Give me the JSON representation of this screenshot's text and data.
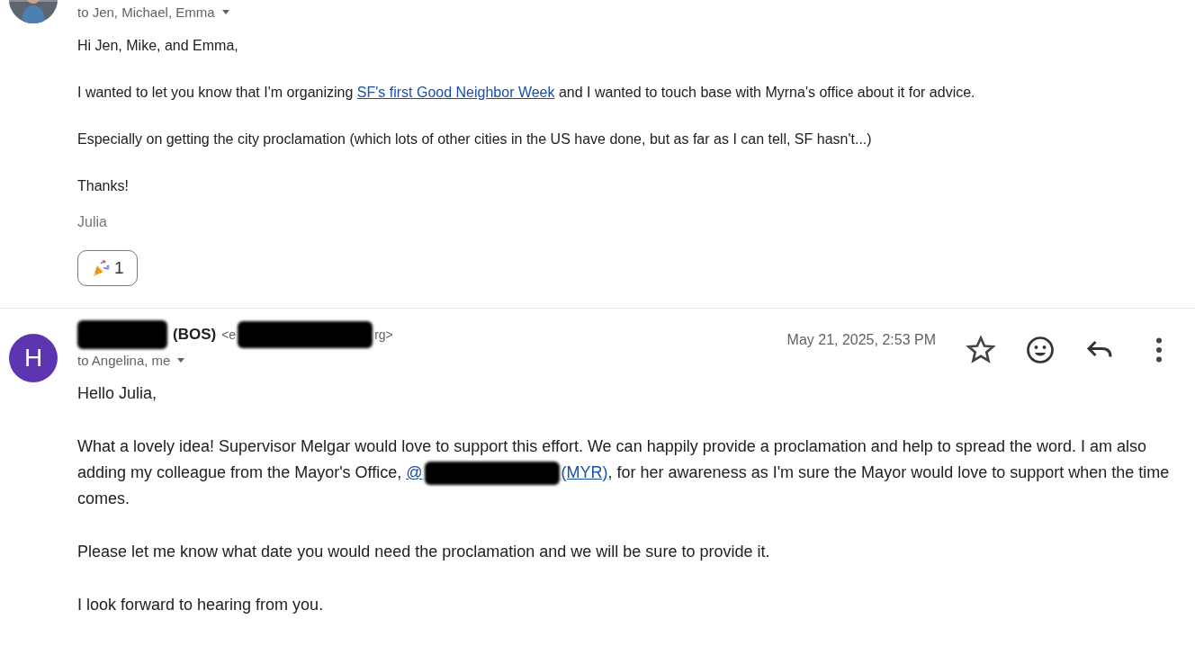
{
  "messages": [
    {
      "avatar": {
        "kind": "picture"
      },
      "recipients": "to Jen, Michael, Emma",
      "paragraphs": [
        [
          {
            "kind": "text",
            "text": "Hi Jen, Mike, and Emma,"
          }
        ],
        [
          {
            "kind": "text",
            "text": "I wanted to let you know that I'm organizing "
          },
          {
            "kind": "link",
            "text": "SF's first Good Neighbor Week"
          },
          {
            "kind": "text",
            "text": " and I wanted to touch base with Myrna's office about it for advice."
          }
        ],
        [
          {
            "kind": "text",
            "text": "Especially on getting the city proclamation (which lots of other cities in the US have done, but as far as I can tell, SF hasn't...)"
          }
        ],
        [
          {
            "kind": "text",
            "text": "Thanks!"
          }
        ]
      ],
      "signature": "Julia",
      "reactions": [
        {
          "count": "1"
        }
      ]
    },
    {
      "avatar": {
        "kind": "letter",
        "letter": "H",
        "color": "#5e35b1"
      },
      "sender": {
        "name": "(BOS)",
        "email_start": "<e",
        "email_end": "rg>"
      },
      "date": "May 21, 2025, 2:53 PM",
      "recipients": "to Angelina, me",
      "paragraphs": [
        [
          {
            "kind": "text",
            "text": "Hello Julia,"
          }
        ],
        [
          {
            "kind": "text",
            "text": "What a lovely idea! Supervisor Melgar would love to support this effort. We can happily provide a proclamation and help to spread the word. I am also adding my colleague from the Mayor's Office, "
          },
          {
            "kind": "mention",
            "start": "@",
            "end": " (MYR)"
          },
          {
            "kind": "text",
            "text": ", for her awareness as I'm sure the Mayor would love to support when the time comes."
          }
        ],
        [
          {
            "kind": "text",
            "text": "Please let me know what date you would need the proclamation and we will be sure to provide it."
          }
        ],
        [
          {
            "kind": "text",
            "text": "I look forward to hearing from you."
          }
        ]
      ]
    }
  ]
}
